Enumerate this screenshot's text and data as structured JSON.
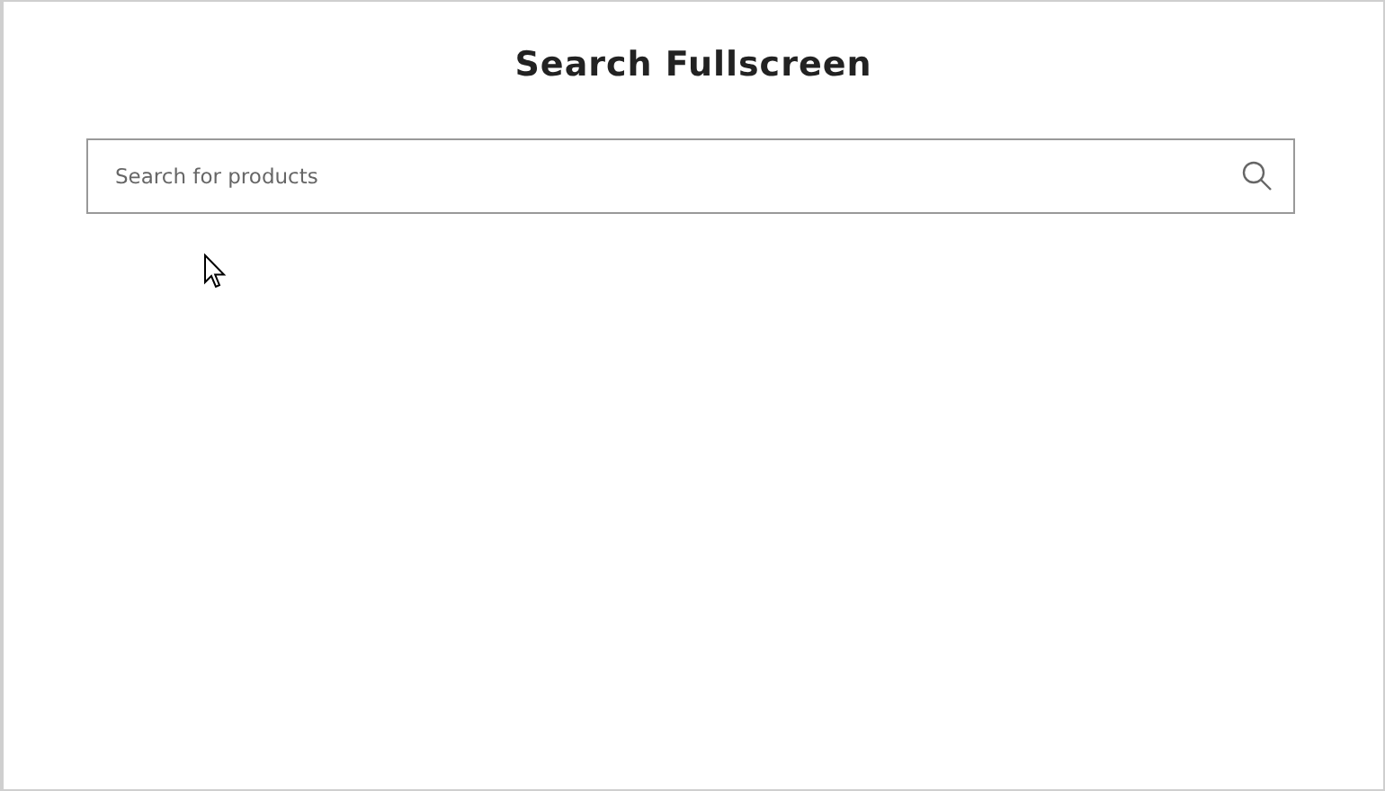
{
  "title": "Search Fullscreen",
  "search": {
    "placeholder": "Search for products"
  }
}
